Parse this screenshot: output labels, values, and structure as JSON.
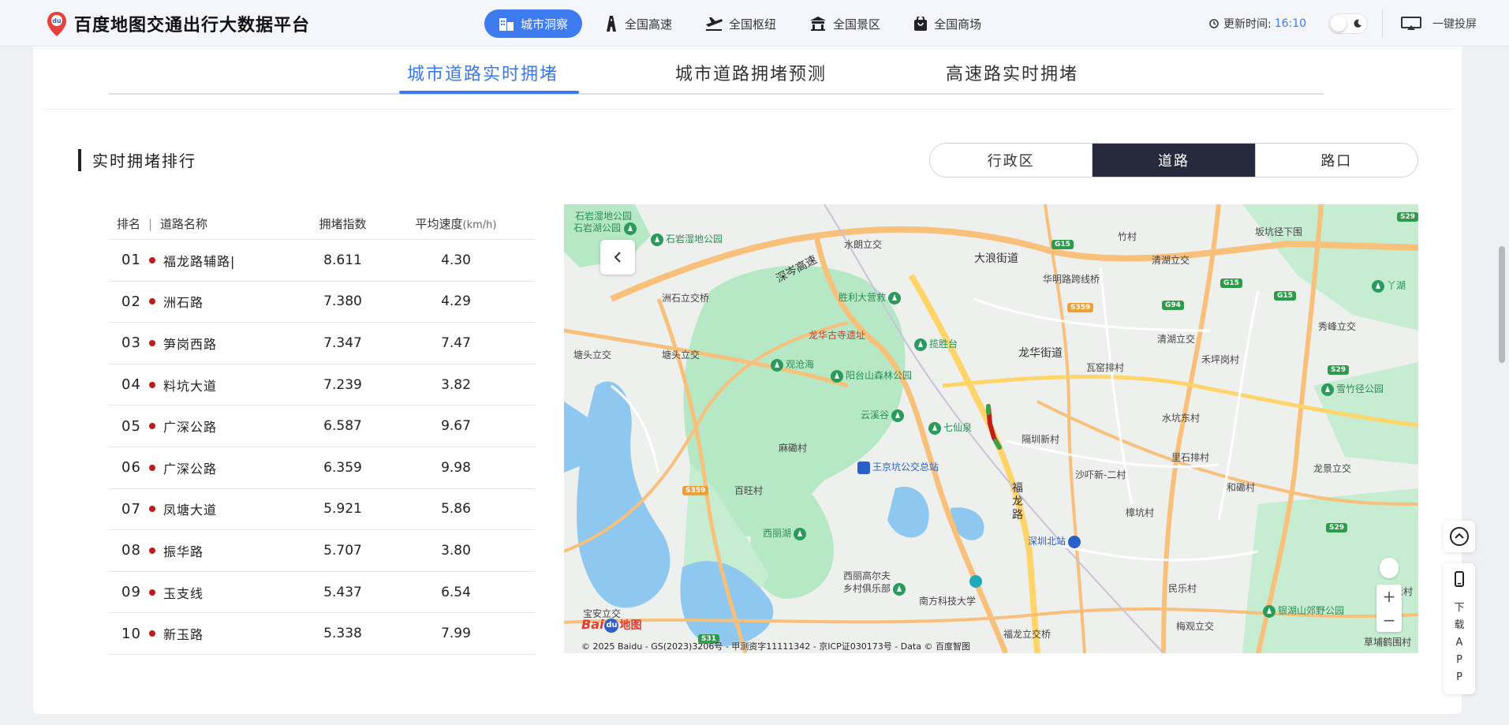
{
  "header": {
    "title": "百度地图交通出行大数据平台",
    "nav": [
      {
        "label": "城市洞察",
        "icon": "building-icon",
        "active": true
      },
      {
        "label": "全国高速",
        "icon": "highway-icon",
        "active": false
      },
      {
        "label": "全国枢纽",
        "icon": "plane-icon",
        "active": false
      },
      {
        "label": "全国景区",
        "icon": "temple-icon",
        "active": false
      },
      {
        "label": "全国商场",
        "icon": "shopping-bag-icon",
        "active": false
      }
    ],
    "update_label": "更新时间:",
    "update_time": "16:10",
    "cast_label": "一键投屏"
  },
  "subtabs": [
    "城市道路实时拥堵",
    "城市道路拥堵预测",
    "高速路实时拥堵"
  ],
  "section_title": "实时拥堵排行",
  "segment": {
    "options": [
      "行政区",
      "道路",
      "路口"
    ],
    "active": "道路"
  },
  "table": {
    "headers": {
      "rank": "排名",
      "name": "道路名称",
      "index": "拥堵指数",
      "speed": "平均速度",
      "speed_unit": "(km/h)"
    },
    "rows": [
      {
        "rank": "01",
        "name": "福龙路辅路|",
        "index": "8.611",
        "speed": "4.30"
      },
      {
        "rank": "02",
        "name": "洲石路",
        "index": "7.380",
        "speed": "4.29"
      },
      {
        "rank": "03",
        "name": "笋岗西路",
        "index": "7.347",
        "speed": "7.47"
      },
      {
        "rank": "04",
        "name": "料坑大道",
        "index": "7.239",
        "speed": "3.82"
      },
      {
        "rank": "05",
        "name": "广深公路",
        "index": "6.587",
        "speed": "9.67"
      },
      {
        "rank": "06",
        "name": "广深公路",
        "index": "6.359",
        "speed": "9.98"
      },
      {
        "rank": "07",
        "name": "凤塘大道",
        "index": "5.921",
        "speed": "5.86"
      },
      {
        "rank": "08",
        "name": "振华路",
        "index": "5.707",
        "speed": "3.80"
      },
      {
        "rank": "09",
        "name": "玉支线",
        "index": "5.437",
        "speed": "6.54"
      },
      {
        "rank": "10",
        "name": "新玉路",
        "index": "5.338",
        "speed": "7.99"
      }
    ]
  },
  "map": {
    "labels": {
      "shiyan_wetland": "石岩湿地公园",
      "shiyan_lake": "石岩湖公园",
      "shiyan_wetland2": "石岩湿地公园",
      "shuilang": "水朗立交",
      "dalang": "大浪街道",
      "zhucun": "竹村",
      "bankeng": "坂坑径下围",
      "qinghu1": "清湖立交",
      "qinghu2": "清湖立交",
      "shenchen": "深岑高速",
      "zhoushi": "洲石立交桥",
      "huaming": "华明路跨线桥",
      "shengli": "胜利大营救",
      "longhua_temple": "龙华古寺遗址",
      "lansheng": "揽胜台",
      "longhua_st": "龙华街道",
      "tangtou1": "塘头立交",
      "tangtou2": "塘头立交",
      "guancanghai": "观沧海",
      "yangtai": "阳台山森林公园",
      "wayao": "瓦窑排村",
      "hefen": "禾坪岗村",
      "xuezhu": "雪竹径公园",
      "yunxi": "云溪谷",
      "qixian": "七仙泉",
      "shuikeng": "水坑东村",
      "gexin": "隔圳新村",
      "mabi": "麻磡村",
      "wangjing": "王京坑公交总站",
      "shazhan": "沙吓新-二村",
      "lishi": "里石排村",
      "hehe": "和磡村",
      "longjing": "龙景立交",
      "baiwang": "百旺村",
      "fulong_road": "福龙路",
      "zhangkeng": "樟坑村",
      "xili_lake": "西丽湖",
      "shenzhen_north": "深圳北站",
      "xili_golf1": "西丽高尔夫",
      "xili_golf2": "乡村俱乐部",
      "sustech": "南方科技大学",
      "minle": "民乐村",
      "yinhu": "银湖山郊野公园",
      "baoan": "宝安立交",
      "fulong_ic": "福龙立交桥",
      "meiguan": "梅观立交",
      "caopu": "草埔鹤围村",
      "donglao": "东老村",
      "yahu": "丫湖",
      "jiang": "秀峰立交"
    },
    "shields": {
      "g15a": "G15",
      "g15b": "G15",
      "g15c": "G15",
      "g94": "G94",
      "s29a": "S29",
      "s29b": "S29",
      "s29c": "S29",
      "s359a": "S359",
      "s359b": "S359",
      "s31": "S31"
    },
    "logo_text": "Bai",
    "logo_du": "du",
    "logo_map": "地图",
    "copyright": "© 2025 Baidu - GS(2023)3206号 - 甲测资字11111342 - 京ICP证030173号 - Data © 百度智图",
    "zoom_in": "+",
    "zoom_out": "−"
  },
  "float": {
    "download_app": "下载APP"
  },
  "colors": {
    "accent": "#3a78ee",
    "dark": "#262a3c",
    "dot": "#c21a1a"
  }
}
